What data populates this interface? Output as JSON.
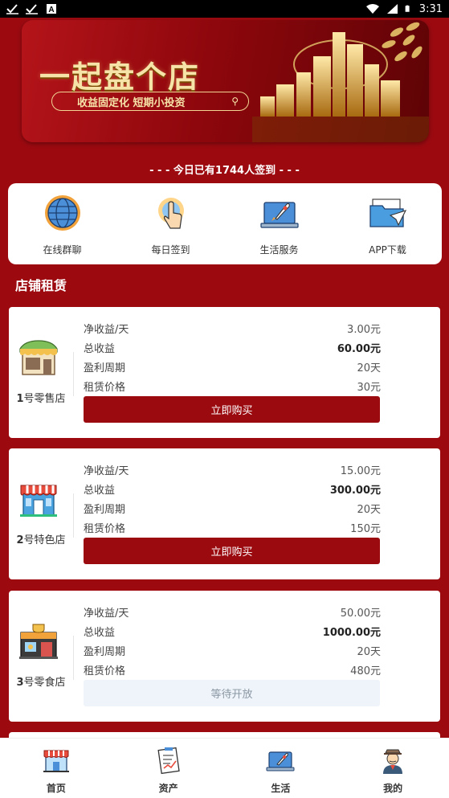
{
  "status_bar": {
    "time": "3:31"
  },
  "banner": {
    "title": "一起盘个店",
    "slogan": "收益固定化  短期小投资"
  },
  "signin_notice": "- - - 今日已有1744人签到 - - -",
  "quick_menu": [
    {
      "label": "在线群聊",
      "icon": "globe-icon"
    },
    {
      "label": "每日签到",
      "icon": "hand-tap-icon"
    },
    {
      "label": "生活服务",
      "icon": "rocket-laptop-icon"
    },
    {
      "label": "APP下载",
      "icon": "folder-plane-icon"
    }
  ],
  "section_title": "店铺租赁",
  "shops": [
    {
      "num": "1",
      "name": "号零售店",
      "icon": "retail-store-icon",
      "rows": [
        {
          "label": "净收益/天",
          "value": "3.00元"
        },
        {
          "label": "总收益",
          "value": "60.00元"
        },
        {
          "label": "盈利周期",
          "value": "20天"
        },
        {
          "label": "租赁价格",
          "value": "30元"
        }
      ],
      "button": "立即购买"
    },
    {
      "num": "2",
      "name": "号特色店",
      "icon": "specialty-store-icon",
      "rows": [
        {
          "label": "净收益/天",
          "value": "15.00元"
        },
        {
          "label": "总收益",
          "value": "300.00元"
        },
        {
          "label": "盈利周期",
          "value": "20天"
        },
        {
          "label": "租赁价格",
          "value": "150元"
        }
      ],
      "button": "立即购买"
    },
    {
      "num": "3",
      "name": "号零食店",
      "icon": "snack-store-icon",
      "rows": [
        {
          "label": "净收益/天",
          "value": "50.00元"
        },
        {
          "label": "总收益",
          "value": "1000.00元"
        },
        {
          "label": "盈利周期",
          "value": "20天"
        },
        {
          "label": "租赁价格",
          "value": "480元"
        }
      ],
      "button": "等待开放"
    }
  ],
  "bottom_nav": [
    {
      "label": "首页",
      "icon": "shop-home-icon"
    },
    {
      "label": "资产",
      "icon": "assets-clipboard-icon"
    },
    {
      "label": "生活",
      "icon": "rocket-laptop-icon"
    },
    {
      "label": "我的",
      "icon": "user-avatar-icon"
    }
  ],
  "colors": {
    "primary": "#9c0a10",
    "gold": "#f6e3a8",
    "wait_bg": "#eef4fa"
  }
}
